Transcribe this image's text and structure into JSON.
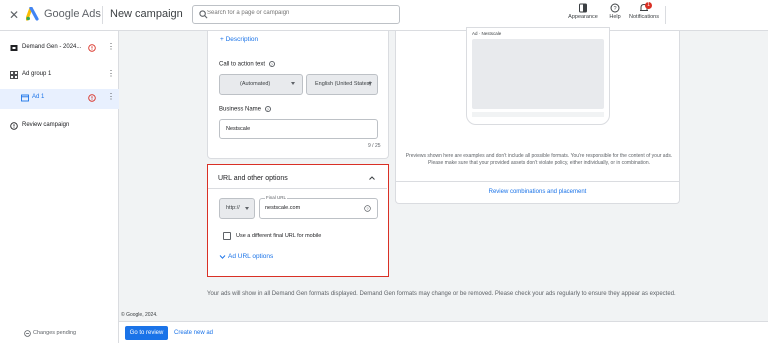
{
  "header": {
    "brand": "Google Ads",
    "page_title": "New campaign",
    "search_placeholder": "Search for a page or campaign",
    "tools": {
      "appearance": "Appearance",
      "help": "Help",
      "notifications": "Notifications",
      "notification_count": "1"
    }
  },
  "sidebar": {
    "items": [
      {
        "label": "Demand Gen - 2024...",
        "has_error": true
      },
      {
        "label": "Ad group 1",
        "has_error": false
      },
      {
        "label": "Ad 1",
        "has_error": true,
        "selected": true
      },
      {
        "label": "Review campaign",
        "has_error": false
      }
    ],
    "changes": "Changes pending"
  },
  "ad_form": {
    "add_description": "+ Description",
    "cta_label": "Call to action text",
    "cta_value": "(Automated)",
    "language_value": "English (United States)",
    "business_name_label": "Business Name",
    "business_name_value": "Nestscale",
    "business_name_count": "9 / 25"
  },
  "url_options": {
    "title": "URL and other options",
    "protocol": "http://",
    "final_url_label": "Final URL",
    "final_url_value": "nestscale.com",
    "mobile_checkbox_label": "Use a different final URL for mobile",
    "ad_url_options": "Ad URL options"
  },
  "preview": {
    "ad_label": "Ad · Nestscale",
    "disclaimer": "Previews shown here are examples and don't include all possible formats. You're responsible for the content of your ads. Please make sure that your provided assets don't violate policy, either individually, or in combination.",
    "review_link": "Review combinations and placement"
  },
  "footer": {
    "note": "Your ads will show in all Demand Gen formats displayed. Demand Gen formats may change or be removed. Please check your ads regularly to ensure they appear as expected.",
    "copyright": "© Google, 2024."
  },
  "actions": {
    "review": "Go to review",
    "create": "Create new ad"
  },
  "colors": {
    "accent": "#1a73e8",
    "error": "#d93025",
    "highlight_border": "#d93025"
  }
}
